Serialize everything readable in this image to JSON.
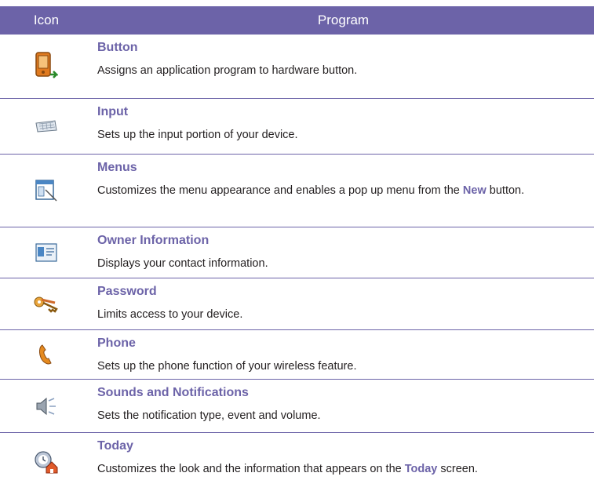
{
  "header": {
    "icon": "Icon",
    "program": "Program"
  },
  "rows": [
    {
      "title": "Button",
      "description": "Assigns an application program to hardware button.",
      "icon": "pda-button-icon"
    },
    {
      "title": "Input",
      "description": "Sets up the input portion of your device.",
      "icon": "keyboard-icon"
    },
    {
      "title": "Menus",
      "desc_before": "Customizes the menu appearance and enables a pop up menu from the",
      "desc_keyword": "New",
      "desc_after": "button.",
      "icon": "menu-window-icon"
    },
    {
      "title": "Owner Information",
      "description": "Displays your contact information.",
      "icon": "contact-card-icon"
    },
    {
      "title": "Password",
      "description": "Limits access to your device.",
      "icon": "keys-icon"
    },
    {
      "title": "Phone",
      "description": "Sets up the phone function of your wireless feature.",
      "icon": "phone-handset-icon"
    },
    {
      "title": "Sounds and Notifications",
      "description": "Sets the notification type, event and volume.",
      "icon": "speaker-icon"
    },
    {
      "title": "Today",
      "desc_before": "Customizes the look and the information that appears on the",
      "desc_keyword": "Today",
      "desc_after": "screen.",
      "icon": "clock-home-icon"
    }
  ],
  "colors": {
    "accent": "#6c63a8",
    "text": "#231f20"
  }
}
